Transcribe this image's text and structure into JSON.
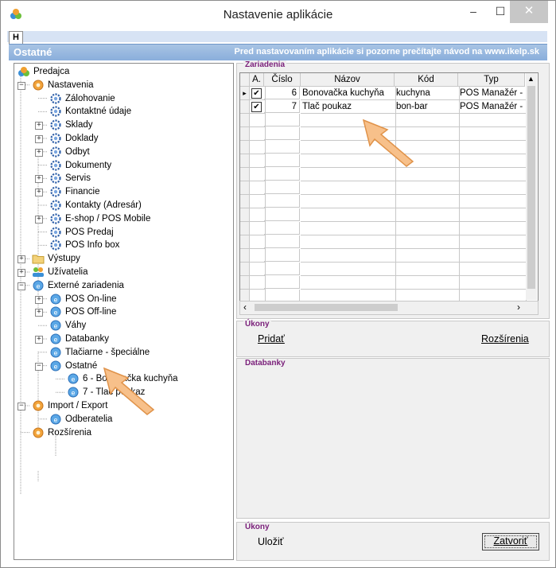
{
  "window": {
    "title": "Nastavenie aplikácie",
    "minimize": "–",
    "maximize": "☐",
    "close": "✕"
  },
  "tabs": {
    "h_label": "H"
  },
  "banner": {
    "section": "Ostatné",
    "notice": "Pred nastavovaním aplikácie si pozorne prečítajte návod na www.ikelp.sk"
  },
  "tree": [
    {
      "label": "Predajca",
      "icon": "app-icon",
      "level": 0,
      "expander": ""
    },
    {
      "label": "Nastavenia",
      "icon": "gear-orange-icon",
      "level": 1,
      "expander": "-"
    },
    {
      "label": "Zálohovanie",
      "icon": "gear-blue-icon",
      "level": 2,
      "expander": ""
    },
    {
      "label": "Kontaktné údaje",
      "icon": "gear-blue-icon",
      "level": 2,
      "expander": ""
    },
    {
      "label": "Sklady",
      "icon": "gear-blue-icon",
      "level": 2,
      "expander": "+"
    },
    {
      "label": "Doklady",
      "icon": "gear-blue-icon",
      "level": 2,
      "expander": "+"
    },
    {
      "label": "Odbyt",
      "icon": "gear-blue-icon",
      "level": 2,
      "expander": "+"
    },
    {
      "label": "Dokumenty",
      "icon": "gear-blue-icon",
      "level": 2,
      "expander": ""
    },
    {
      "label": "Servis",
      "icon": "gear-blue-icon",
      "level": 2,
      "expander": "+"
    },
    {
      "label": "Financie",
      "icon": "gear-blue-icon",
      "level": 2,
      "expander": "+"
    },
    {
      "label": "Kontakty (Adresár)",
      "icon": "gear-blue-icon",
      "level": 2,
      "expander": ""
    },
    {
      "label": "E-shop / POS Mobile",
      "icon": "gear-blue-icon",
      "level": 2,
      "expander": "+"
    },
    {
      "label": "POS Predaj",
      "icon": "gear-blue-icon",
      "level": 2,
      "expander": ""
    },
    {
      "label": "POS Info box",
      "icon": "gear-blue-icon",
      "level": 2,
      "expander": ""
    },
    {
      "label": "Výstupy",
      "icon": "folder-icon",
      "level": 1,
      "expander": "+"
    },
    {
      "label": "Užívatelia",
      "icon": "users-icon",
      "level": 1,
      "expander": "+"
    },
    {
      "label": "Externé zariadenia",
      "icon": "device-icon",
      "level": 1,
      "expander": "-"
    },
    {
      "label": "POS On-line",
      "icon": "device-icon",
      "level": 2,
      "expander": "+"
    },
    {
      "label": "POS Off-line",
      "icon": "device-icon",
      "level": 2,
      "expander": "+"
    },
    {
      "label": "Váhy",
      "icon": "device-icon",
      "level": 2,
      "expander": ""
    },
    {
      "label": "Databanky",
      "icon": "device-icon",
      "level": 2,
      "expander": "+"
    },
    {
      "label": "Tlačiarne - špeciálne",
      "icon": "device-icon",
      "level": 2,
      "expander": ""
    },
    {
      "label": "Ostatné",
      "icon": "device-icon",
      "level": 2,
      "expander": "-"
    },
    {
      "label": "6 - Bonovačka kuchyňa",
      "icon": "device-icon",
      "level": 3,
      "expander": ""
    },
    {
      "label": "7 - Tlač poukaz",
      "icon": "device-icon",
      "level": 3,
      "expander": ""
    },
    {
      "label": "Import / Export",
      "icon": "gear-orange-icon",
      "level": 1,
      "expander": "-"
    },
    {
      "label": "Odberatelia",
      "icon": "device-icon",
      "level": 2,
      "expander": ""
    },
    {
      "label": "Rozšírenia",
      "icon": "gear-orange-icon",
      "level": 1,
      "expander": ""
    }
  ],
  "zariadenia": {
    "title": "Zariadenia",
    "columns": [
      "A.",
      "Číslo",
      "Názov",
      "Kód",
      "Typ"
    ],
    "rows": [
      {
        "active": "✔",
        "cislo": "6",
        "nazov": "Bonovačka kuchyňa",
        "kod": "kuchyna",
        "typ": "POS Manažér - "
      },
      {
        "active": "✔",
        "cislo": "7",
        "nazov": "Tlač poukaz",
        "kod": "bon-bar",
        "typ": "POS Manažér - "
      }
    ]
  },
  "ukony1": {
    "title": "Úkony",
    "pridat": "Pridať",
    "rozsirenia": "Rozšírenia"
  },
  "databanky": {
    "title": "Databanky"
  },
  "ukony2": {
    "title": "Úkony",
    "ulozit": "Uložiť",
    "zatvorit": "Zatvoriť"
  },
  "colors": {
    "banner": "#8aaedb",
    "group_title": "#7a1f7a",
    "arrow": "#f7c08a"
  }
}
